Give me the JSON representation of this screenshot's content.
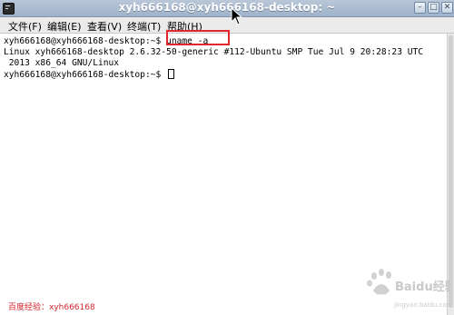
{
  "window": {
    "title": "xyh666168@xyh666168-desktop: ~",
    "minimize_symbol": "–",
    "maximize_symbol": "□",
    "close_symbol": "✕"
  },
  "menubar": {
    "items": [
      {
        "label": "文件(F)"
      },
      {
        "label": "编辑(E)"
      },
      {
        "label": "查看(V)"
      },
      {
        "label": "终端(T)"
      },
      {
        "label": "帮助(H)"
      }
    ]
  },
  "terminal": {
    "lines": [
      {
        "prompt": "xyh666168@xyh666168-desktop:~$ ",
        "command": "uname -a"
      },
      {
        "text": "Linux xyh666168-desktop 2.6.32-50-generic #112-Ubuntu SMP Tue Jul 9 20:28:23 UTC"
      },
      {
        "text": " 2013 x86_64 GNU/Linux"
      },
      {
        "prompt": "xyh666168@xyh666168-desktop:~$ ",
        "command": ""
      }
    ],
    "highlight_color": "#e2262b"
  },
  "watermark": {
    "caption": "百度经验：xyh666168",
    "logo_text": "Baidu经验",
    "logo_url": "jingyan.baidu.com"
  },
  "colors": {
    "titlebar": "#9fb2c9",
    "menubar": "#ebebeb",
    "terminal_bg": "#ffffff",
    "caption_red": "#d3262d"
  },
  "icons": [
    "terminal-app-icon",
    "minimize-icon",
    "maximize-icon",
    "close-icon",
    "mouse-pointer-icon",
    "baidu-logo-icon"
  ]
}
